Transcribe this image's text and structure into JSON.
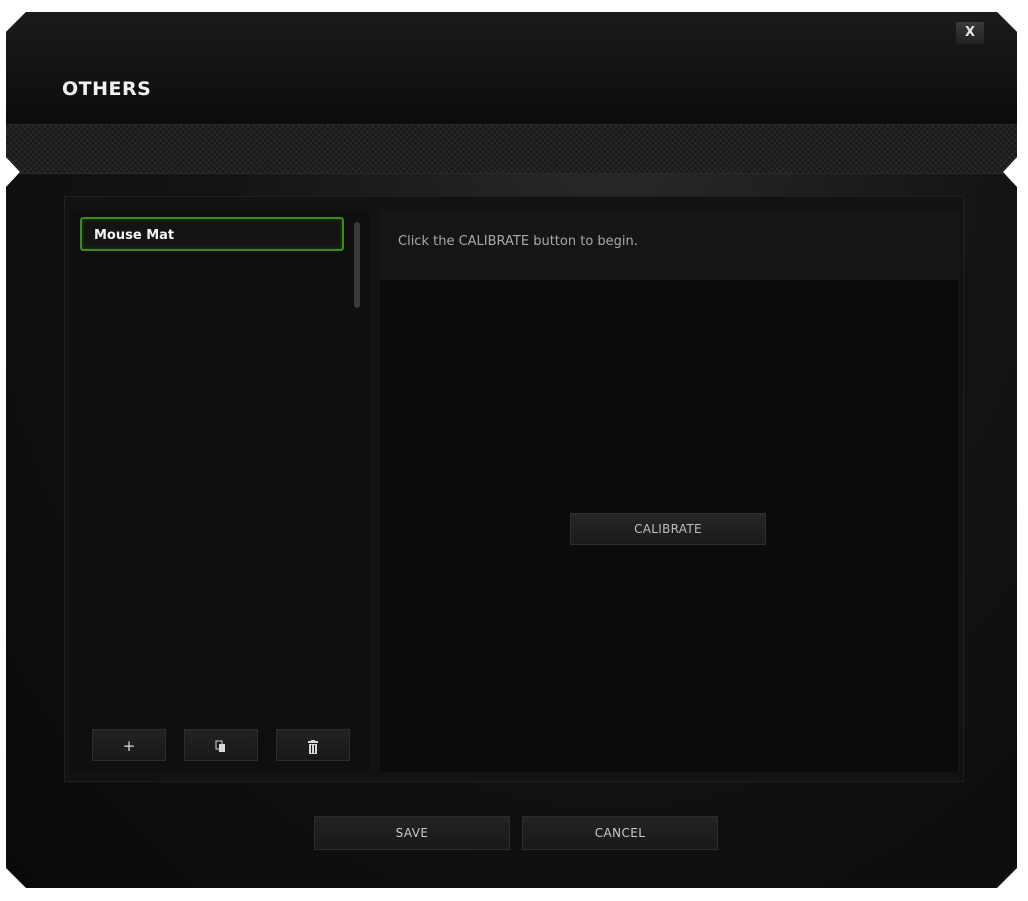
{
  "window": {
    "title": "OTHERS",
    "close_label": "X"
  },
  "list": {
    "items": [
      {
        "label": "Mouse Mat",
        "selected": true
      }
    ],
    "add_label": "+",
    "copy_icon": "copy-icon",
    "delete_icon": "trash-icon"
  },
  "calibration": {
    "instruction": "Click the CALIBRATE button to begin.",
    "calibrate_label": "CALIBRATE"
  },
  "footer": {
    "save_label": "SAVE",
    "cancel_label": "CANCEL"
  },
  "colors": {
    "accent_green": "#44d62c",
    "background": "#0b0b0b"
  }
}
